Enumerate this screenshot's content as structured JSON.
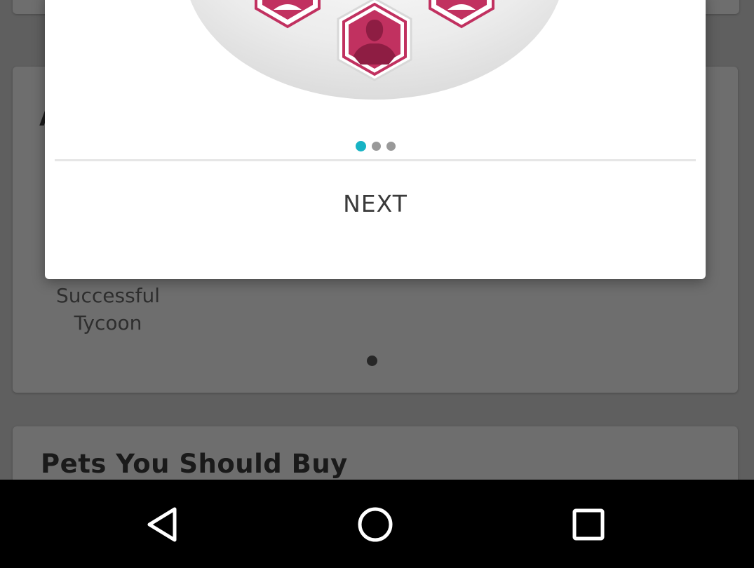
{
  "background": {
    "achievement_label_line1": "Successful",
    "achievement_label_line2": "Tycoon",
    "hidden_title_initial": "A",
    "pets_section_title": "Pets You Should Buy"
  },
  "modal": {
    "next_label": "NEXT",
    "pager": {
      "count": 3,
      "active_index": 0
    },
    "illustration_icon": "profile-hexagons-icon",
    "colors": {
      "accent": "#c13160",
      "active_dot": "#17b3c4",
      "inactive_dot": "#999999"
    }
  },
  "navbar": {
    "icons": [
      "back-triangle-icon",
      "home-circle-icon",
      "recent-square-icon"
    ]
  }
}
